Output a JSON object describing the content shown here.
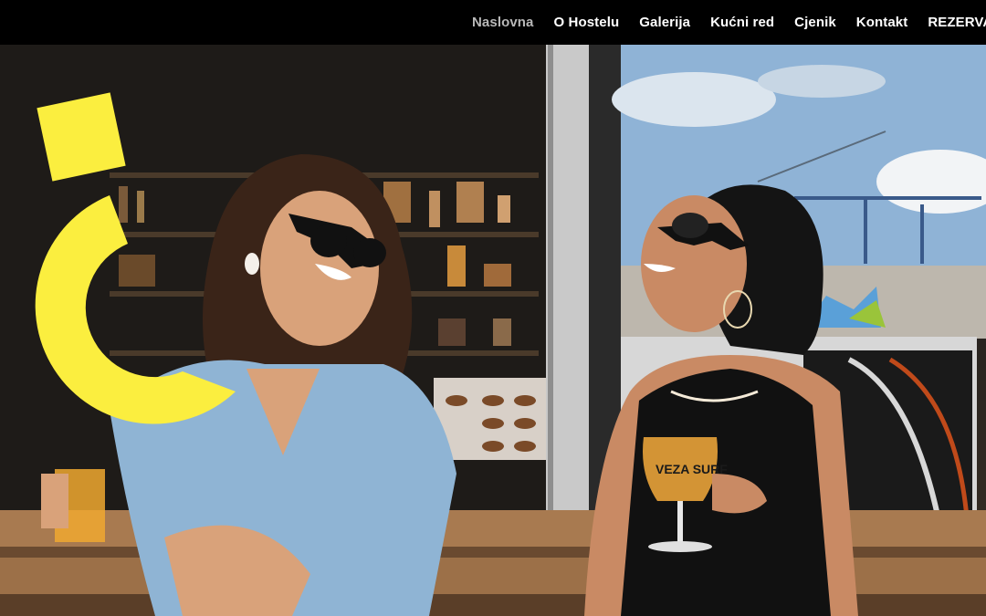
{
  "nav": {
    "items": [
      {
        "label": "Naslovna",
        "active": true
      },
      {
        "label": "O Hostelu",
        "active": false
      },
      {
        "label": "Galerija",
        "active": false
      },
      {
        "label": "Kućni red",
        "active": false
      },
      {
        "label": "Cjenik",
        "active": false
      },
      {
        "label": "Kontakt",
        "active": false
      },
      {
        "label": "REZERVACIJE",
        "active": false
      }
    ]
  },
  "hero": {
    "glass_label": "VEZA SURF"
  },
  "colors": {
    "topbar": "#000000",
    "nav_text": "#ffffff",
    "nav_active": "#b8b8b8",
    "accent_yellow": "#fbee3f"
  }
}
